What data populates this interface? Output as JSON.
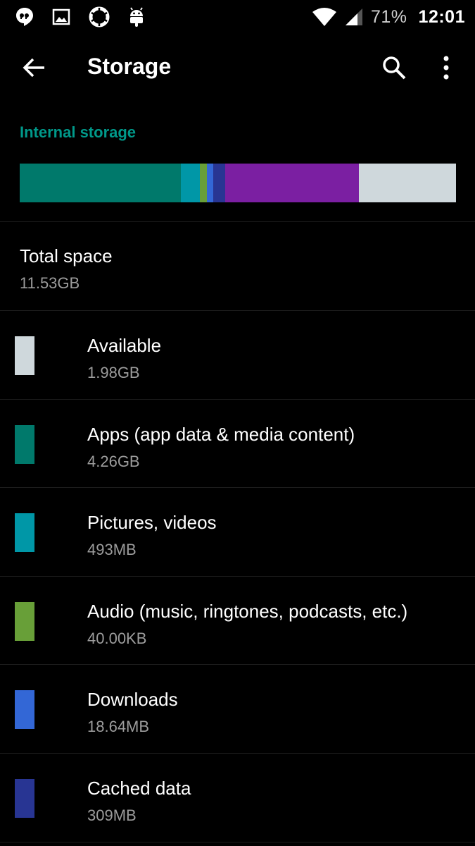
{
  "status_bar": {
    "icons": [
      "quote-notification-icon",
      "image-notification-icon",
      "aperture-notification-icon",
      "android-notification-icon"
    ],
    "battery": "71%",
    "time": "12:01"
  },
  "toolbar": {
    "title": "Storage",
    "back_icon": "arrow-left-icon",
    "search_icon": "search-icon",
    "menu_icon": "more-vert-icon"
  },
  "storage": {
    "header": "Internal storage",
    "accent": "#00998a",
    "segments": [
      {
        "name": "apps",
        "color": "#00796b",
        "fraction": 0.3695
      },
      {
        "name": "pictures",
        "color": "#0097a7",
        "fraction": 0.0428
      },
      {
        "name": "audio",
        "color": "#689f38",
        "fraction": 0.016
      },
      {
        "name": "downloads",
        "color": "#3367d6",
        "fraction": 0.016
      },
      {
        "name": "cached",
        "color": "#283593",
        "fraction": 0.0268
      },
      {
        "name": "other",
        "color": "#7b1fa2",
        "fraction": 0.307
      },
      {
        "name": "available",
        "color": "#cfd8dc",
        "fraction": 0.2219
      }
    ],
    "total": {
      "label": "Total space",
      "value": "11.53GB"
    },
    "items": [
      {
        "label": "Available",
        "value": "1.98GB",
        "color": "#cfd8dc"
      },
      {
        "label": "Apps (app data & media content)",
        "value": "4.26GB",
        "color": "#00796b"
      },
      {
        "label": "Pictures, videos",
        "value": "493MB",
        "color": "#0097a7"
      },
      {
        "label": "Audio (music, ringtones, podcasts, etc.)",
        "value": "40.00KB",
        "color": "#689f38"
      },
      {
        "label": "Downloads",
        "value": "18.64MB",
        "color": "#3367d6"
      },
      {
        "label": "Cached data",
        "value": "309MB",
        "color": "#283593"
      }
    ]
  }
}
